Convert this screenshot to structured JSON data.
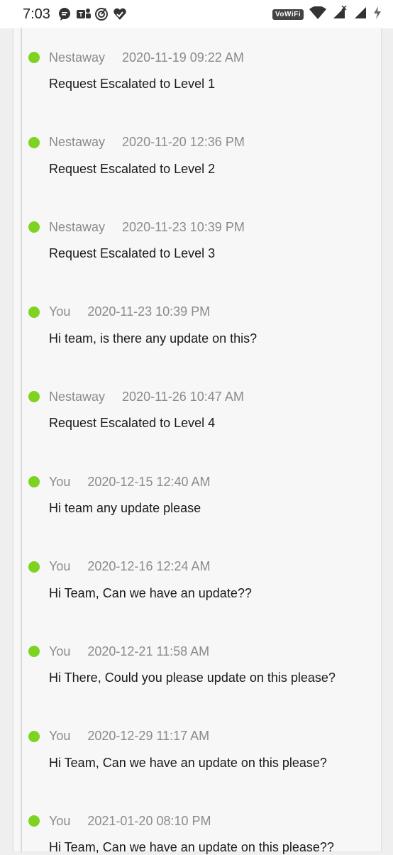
{
  "status_bar": {
    "time": "7:03",
    "vowifi_label": "VoWiFi"
  },
  "timeline": [
    {
      "author": "Nestaway",
      "timestamp": "2020-11-19 09:22 AM",
      "message": "Request Escalated to Level 1"
    },
    {
      "author": "Nestaway",
      "timestamp": "2020-11-20 12:36 PM",
      "message": "Request Escalated to Level 2"
    },
    {
      "author": "Nestaway",
      "timestamp": "2020-11-23 10:39 PM",
      "message": "Request Escalated to Level 3"
    },
    {
      "author": "You",
      "timestamp": "2020-11-23 10:39 PM",
      "message": "Hi team, is there any update on this?"
    },
    {
      "author": "Nestaway",
      "timestamp": "2020-11-26 10:47 AM",
      "message": "Request Escalated to Level 4"
    },
    {
      "author": "You",
      "timestamp": "2020-12-15 12:40 AM",
      "message": "Hi team any update please"
    },
    {
      "author": "You",
      "timestamp": "2020-12-16 12:24 AM",
      "message": "Hi Team, Can we have an update??"
    },
    {
      "author": "You",
      "timestamp": "2020-12-21 11:58 AM",
      "message": "Hi There, Could you please update on this please?"
    },
    {
      "author": "You",
      "timestamp": "2020-12-29 11:17 AM",
      "message": "Hi Team, Can we have an update on this please?"
    },
    {
      "author": "You",
      "timestamp": "2021-01-20 08:10 PM",
      "message": "Hi Team, Can we have an update on this please??"
    }
  ],
  "colors": {
    "dot": "#7ed321",
    "meta_text": "#8b8b8b",
    "message_text": "#1a1a1a"
  }
}
